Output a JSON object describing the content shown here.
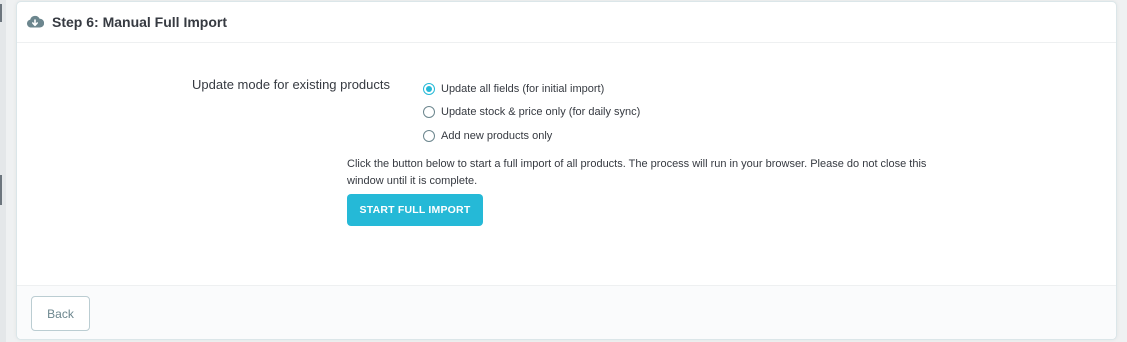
{
  "panel": {
    "title": "Step 6: Manual Full Import",
    "icon": "cloud-download-icon"
  },
  "form": {
    "update_mode_label": "Update mode for existing products",
    "options": [
      {
        "label": "Update all fields (for initial import)",
        "checked": true
      },
      {
        "label": "Update stock & price only (for daily sync)",
        "checked": false
      },
      {
        "label": "Add new products only",
        "checked": false
      }
    ],
    "help_text": "Click the button below to start a full import of all products. The process will run in your browser. Please do not close this window until it is complete.",
    "start_button_label": "START FULL IMPORT"
  },
  "footer": {
    "back_label": "Back"
  },
  "colors": {
    "accent": "#25b9d7",
    "text": "#363a41",
    "background": "#eff1f2"
  }
}
